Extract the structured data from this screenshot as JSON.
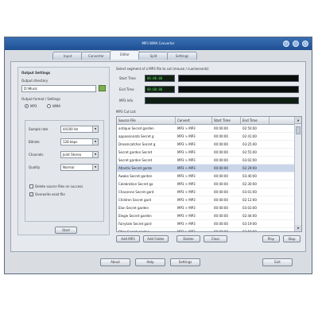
{
  "window": {
    "title": "MP3 WMA Converter",
    "tabs": [
      "Input",
      "Converter",
      "Editor",
      "Split",
      "Settings"
    ],
    "active_tab": 2
  },
  "left_panel": {
    "header": "Output Settings",
    "output_dir_label": "Output directory",
    "output_dir_value": "D:\\Music",
    "output_format_label": "Output format / Settings",
    "formats": [
      "MP3",
      "WMA"
    ],
    "selected_format": "MP3",
    "settings": [
      {
        "label": "Sample rate",
        "value": "44100 Hz"
      },
      {
        "label": "Bitrate",
        "value": "128 kbps"
      },
      {
        "label": "Channels",
        "value": "Joint Stereo"
      },
      {
        "label": "Quality",
        "value": "Normal"
      }
    ],
    "options": [
      {
        "label": "Delete source files on success",
        "checked": false
      },
      {
        "label": "Overwrite exist file",
        "checked": true
      }
    ],
    "button": "Start"
  },
  "right_panel": {
    "header": "Select segment of a MP3 file to cut (mouse / cue/seconds)",
    "start_time_label": "Start Time",
    "start_time_value": "00:00:00",
    "end_time_label": "End Time",
    "end_time_value": "00:00:00",
    "mp3_info_label": "MP3 Info",
    "list_title": "MP3 Cut List",
    "columns": [
      "Source File",
      "Convert",
      "Start Time",
      "End Time"
    ],
    "rows": [
      [
        "antique Secret garden",
        "MP3 > MP3",
        "00:00:00",
        "02:50:00"
      ],
      [
        "appassionata Secret g",
        "MP3 > MP3",
        "00:00:00",
        "02:41:00"
      ],
      [
        "Dreamcatcher Secret g",
        "MP3 > MP3",
        "00:00:00",
        "03:25:00"
      ],
      [
        "Secret garden Secret",
        "MP3 > MP3",
        "00:00:00",
        "02:55:00"
      ],
      [
        "Secret garden Secret",
        "MP3 > MP3",
        "00:00:00",
        "03:02:00"
      ],
      [
        "Atlantis Secret garde",
        "MP3 > MP3",
        "00:00:00",
        "02:29:00"
      ],
      [
        "Awake Secret garden",
        "MP3 > MP3",
        "00:00:00",
        "03:40:00"
      ],
      [
        "Celebration Secret ga",
        "MP3 > MP3",
        "00:00:00",
        "02:30:00"
      ],
      [
        "Chaconne Secret gard",
        "MP3 > MP3",
        "00:00:00",
        "03:01:00"
      ],
      [
        "Children Secret gard",
        "MP3 > MP3",
        "00:00:00",
        "02:12:00"
      ],
      [
        "Elan Secret garden",
        "MP3 > MP3",
        "00:00:00",
        "03:03:00"
      ],
      [
        "Elegie Secret garden",
        "MP3 > MP3",
        "00:00:00",
        "02:44:00"
      ],
      [
        "Fairytale Secret gard",
        "MP3 > MP3",
        "00:00:00",
        "03:19:00"
      ],
      [
        "Ffion Secret garden",
        "MP3 > MP3",
        "00:00:00",
        "02:58:00"
      ]
    ],
    "selected_row": 5,
    "list_buttons": [
      "Add MP3",
      "Add Folder",
      "Delete",
      "Clear"
    ],
    "play_buttons": [
      "Play",
      "Stop"
    ]
  },
  "footer_buttons": [
    "About",
    "Help",
    "Settings",
    "Exit"
  ],
  "colors": {
    "titlebar": "#2a5fa5",
    "lcd_text": "#5fe05f",
    "selected_row": "#c9d6ea"
  }
}
